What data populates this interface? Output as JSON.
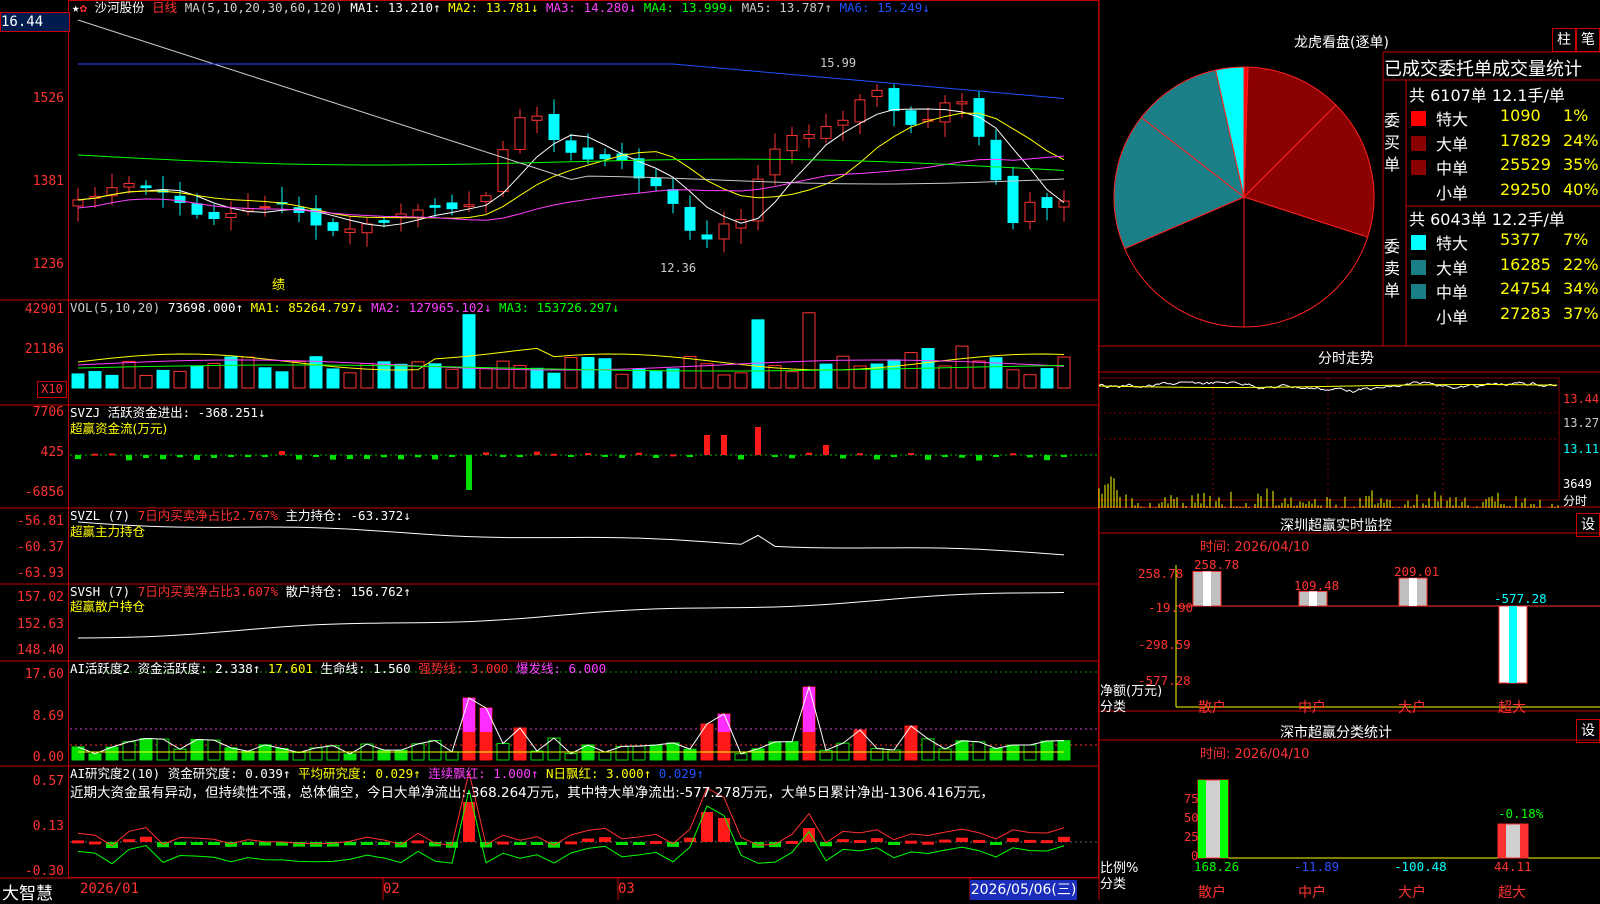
{
  "top": {
    "price_box": "16.44",
    "star": "★",
    "stock_name": "沙河股份",
    "period": "日线"
  },
  "ma_header": {
    "label": "MA(5,10,20,30,60,120)",
    "items": [
      {
        "text": "MA1: 13.210↑",
        "color": "#ffffff"
      },
      {
        "text": "MA2: 13.781↓",
        "color": "#ffff00"
      },
      {
        "text": "MA3: 14.280↓",
        "color": "#ff40ff"
      },
      {
        "text": "MA4: 13.999↓",
        "color": "#00ff00"
      },
      {
        "text": "MA5: 13.787↑",
        "color": "#c8c8c8"
      },
      {
        "text": "MA6: 15.249↓",
        "color": "#2050ff"
      }
    ]
  },
  "price_axis": [
    "1526",
    "1381",
    "1236"
  ],
  "annotations": {
    "high": "15.99",
    "low": "12.36",
    "ji": "绩"
  },
  "vol": {
    "header": "VOL(5,10,20)",
    "value": "73698.000↑",
    "ma1": "MA1: 85264.797↓",
    "ma2": "MA2: 127965.102↓",
    "ma3": "MA3: 153726.297↓",
    "axis": [
      "42901",
      "21186"
    ],
    "unit": "X10"
  },
  "svzj": {
    "header": "SVZJ  活跃资金进出: -368.251↓",
    "sub": "超赢资金流(万元)",
    "axis": [
      "7706",
      "425",
      "-6856"
    ]
  },
  "svzl": {
    "header_a": "SVZL (7)",
    "header_b": "7日内买卖净占比2.767%",
    "header_c": "主力持仓: -63.372↓",
    "sub": "超赢主力持仓",
    "axis": [
      "-56.81",
      "-60.37",
      "-63.93"
    ]
  },
  "svsh": {
    "header_a": "SVSH (7)",
    "header_b": "7日内买卖净占比3.607%",
    "header_c": "散户持仓: 156.762↑",
    "sub": "超赢散户持仓",
    "axis": [
      "157.02",
      "152.63",
      "148.40"
    ]
  },
  "ai_active": {
    "items": [
      {
        "text": "AI活跃度2 资金活跃度: 2.338↑",
        "color": "#ffffff"
      },
      {
        "text": "17.601",
        "color": "#ffff00"
      },
      {
        "text": "生命线: 1.560",
        "color": "#ffffff"
      },
      {
        "text": "强势线: 3.000",
        "color": "#ff3030"
      },
      {
        "text": "爆发线: 6.000",
        "color": "#ff40ff"
      }
    ],
    "axis": [
      "17.60",
      "8.69",
      "0.00"
    ]
  },
  "ai_research": {
    "items": [
      {
        "text": "AI研究度2(10) 资金研究度: 0.039↑",
        "color": "#ffffff"
      },
      {
        "text": "平均研究度: 0.029↑",
        "color": "#ffff00"
      },
      {
        "text": "连续飘红: 1.000↑",
        "color": "#ff40ff"
      },
      {
        "text": "N日飘红: 3.000↑",
        "color": "#ffff00"
      },
      {
        "text": "0.029↑",
        "color": "#2050ff"
      }
    ],
    "commentary": "近期大资金虽有异动，但持续性不强，总体偏空，今日大单净流出:-368.264万元，其中特大单净流出:-577.278万元，大单5日累计净出-1306.416万元，",
    "axis": [
      "0.57",
      "0.13",
      "-0.30"
    ]
  },
  "bottom": {
    "logo": "大智慧",
    "dates": [
      "2026/01",
      "02",
      "03"
    ],
    "current_date": "2026/05/06(三)"
  },
  "lhb": {
    "title": "龙虎看盘(逐单)",
    "btn1": "柱",
    "btn2": "笔",
    "subtitle": "已成交委托单成交量统计",
    "buy": {
      "label": "委买单",
      "summary": "共 6107单 12.1手/单",
      "rows": [
        {
          "label": "特大",
          "value": "1090",
          "pct": "1%",
          "color": "#ff0000"
        },
        {
          "label": "大单",
          "value": "17829",
          "pct": "24%",
          "color": "#8b0000"
        },
        {
          "label": "中单",
          "value": "25529",
          "pct": "35%",
          "color": "#8b0000"
        },
        {
          "label": "小单",
          "value": "29250",
          "pct": "40%",
          "color": "#000000"
        }
      ]
    },
    "sell": {
      "label": "委卖单",
      "summary": "共 6043单 12.2手/单",
      "rows": [
        {
          "label": "特大",
          "value": "5377",
          "pct": "7%",
          "color": "#00ffff"
        },
        {
          "label": "大单",
          "value": "16285",
          "pct": "22%",
          "color": "#1a7f86"
        },
        {
          "label": "中单",
          "value": "24754",
          "pct": "34%",
          "color": "#1a7f86"
        },
        {
          "label": "小单",
          "value": "27283",
          "pct": "37%",
          "color": "#000000"
        }
      ]
    }
  },
  "intraday": {
    "title": "分时走势",
    "axis": [
      "13.44",
      "13.27",
      "13.11"
    ],
    "vol_axis": [
      "3649",
      "分时"
    ]
  },
  "sz_monitor": {
    "title": "深圳超赢实时监控",
    "btn": "设",
    "time": "时间: 2026/04/10",
    "axis": [
      "258.78",
      "-19.90",
      "-298.59",
      "-577.28"
    ],
    "ylabel_1": "净额(万元)",
    "ylabel_2": "分类",
    "categories": [
      "散户",
      "中户",
      "大户",
      "超大"
    ],
    "values": [
      258.78,
      109.48,
      209.01,
      -577.28
    ],
    "value_labels": [
      "258.78",
      "109.48",
      "209.01",
      "-577.28"
    ]
  },
  "sz_stats": {
    "title": "深市超赢分类统计",
    "btn": "设",
    "time": "时间: 2026/04/10",
    "axis": [
      "75",
      "50",
      "25",
      "0"
    ],
    "ylabel_1": "比例%",
    "ylabel_2": "分类",
    "categories": [
      "散户",
      "中户",
      "大户",
      "超大"
    ],
    "values": [
      168.26,
      -11.89,
      -100.48,
      44.11
    ],
    "value_labels": [
      "168.26",
      "-11.89",
      "-100.48",
      "44.11"
    ],
    "extra_label": "-0.18%"
  }
}
